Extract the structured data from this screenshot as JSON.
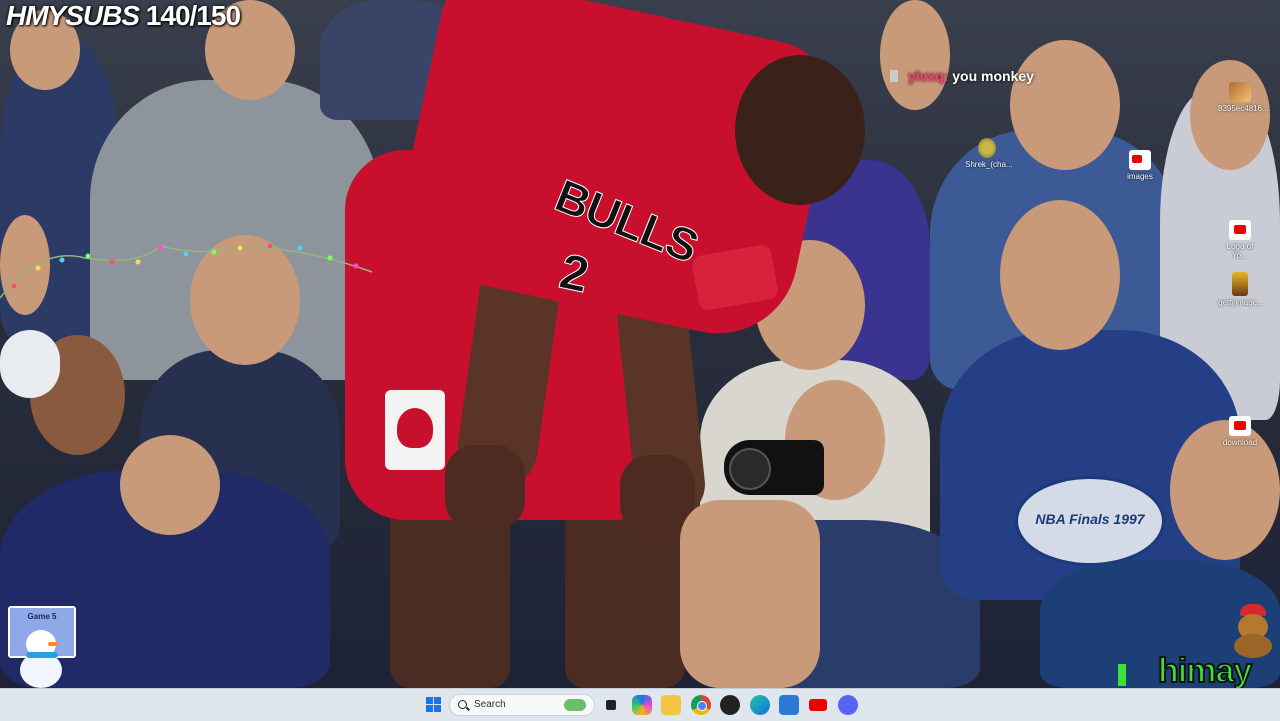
{
  "stream_overlay": {
    "channel_label": "HMYSUBS",
    "sub_goal": "140/150",
    "chat_user": "ylvxq:",
    "chat_message": "you monkey",
    "streamer_logo": "himay"
  },
  "jersey": {
    "team": "BULLS",
    "number": "2"
  },
  "crowd_signs": {
    "finals_text": "NBA Finals 1997",
    "badge_text": "Game 5"
  },
  "desktop_icons": [
    {
      "label": "8395ec4816...",
      "icon": "image-file-icon"
    },
    {
      "label": "Shrek_(cha...",
      "icon": "shrek-file-icon"
    },
    {
      "label": "images",
      "icon": "youtube-file-icon"
    },
    {
      "label": "Logo of Yo...",
      "icon": "youtube-file-icon"
    },
    {
      "label": "gettyimage...",
      "icon": "image-file-icon"
    },
    {
      "label": "download",
      "icon": "youtube-file-icon"
    }
  ],
  "taskbar": {
    "search_placeholder": "Search",
    "apps": [
      "windows-start-icon",
      "search-icon",
      "task-view-icon",
      "copilot-icon",
      "file-explorer-icon",
      "chrome-icon",
      "obs-icon",
      "edge-icon",
      "store-icon",
      "youtube-icon",
      "discord-icon"
    ]
  },
  "colors": {
    "bulls_red": "#c8102e",
    "taskbar_bg": "#dfe6ee",
    "chat_user": "#ff3b6b",
    "himay_green": "#3fe03a"
  }
}
